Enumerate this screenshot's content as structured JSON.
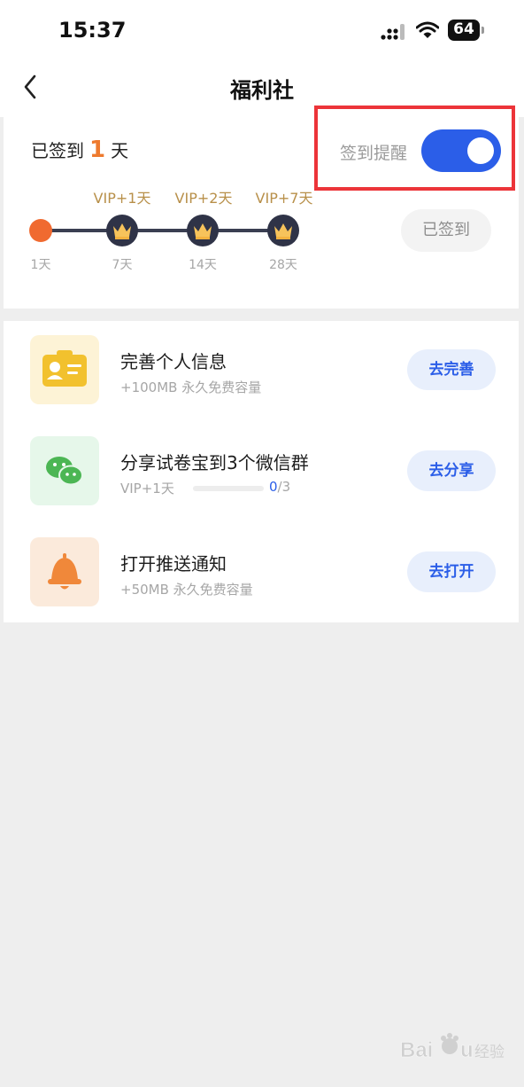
{
  "status_bar": {
    "time": "15:37",
    "battery": "64"
  },
  "nav": {
    "title": "福利社"
  },
  "signin": {
    "prefix": "已签到",
    "count": "1",
    "suffix": "天",
    "reminder_label": "签到提醒",
    "reminder_enabled": true,
    "milestones": [
      {
        "day": "1天",
        "vip": ""
      },
      {
        "day": "7天",
        "vip": "VIP+1天"
      },
      {
        "day": "14天",
        "vip": "VIP+2天"
      },
      {
        "day": "28天",
        "vip": "VIP+7天"
      }
    ],
    "signed_button": "已签到"
  },
  "tasks": [
    {
      "title": "完善个人信息",
      "subtitle": "+100MB 永久免费容量",
      "button": "去完善",
      "icon": "id-card-icon",
      "icon_bg": "#fdf3d6"
    },
    {
      "title": "分享试卷宝到3个微信群",
      "subtitle": "VIP+1天",
      "progress_done": "0",
      "progress_total": "/3",
      "progress_fraction": 0,
      "button": "去分享",
      "icon": "wechat-icon",
      "icon_bg": "#e6f7ea"
    },
    {
      "title": "打开推送通知",
      "subtitle": "+50MB 永久免费容量",
      "button": "去打开",
      "icon": "bell-icon",
      "icon_bg": "#fbeadb"
    }
  ],
  "colors": {
    "accent": "#2b5ee8",
    "orange": "#f06a30",
    "gold": "#b8904a",
    "highlight": "#ec3439"
  },
  "watermark": {
    "text": "经验"
  }
}
